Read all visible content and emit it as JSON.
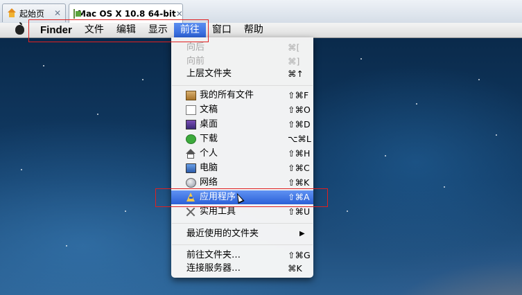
{
  "vm_tabs": [
    {
      "label": "起始页",
      "icon": "home-icon"
    },
    {
      "label": "Mac OS X 10.8 64-bit",
      "icon": "vm-icon"
    }
  ],
  "tab_close": "✕",
  "menubar": {
    "app_name": "Finder",
    "menus": [
      "文件",
      "编辑",
      "显示",
      "前往",
      "窗口",
      "帮助"
    ],
    "active_menu": "前往"
  },
  "go_menu": {
    "items": [
      {
        "label": "向后",
        "shortcut": "⌘[",
        "disabled": true
      },
      {
        "label": "向前",
        "shortcut": "⌘]",
        "disabled": true
      },
      {
        "label": "上层文件夹",
        "shortcut": "⌘↑"
      },
      {
        "label": "我的所有文件",
        "shortcut": "⇧⌘F",
        "icon": "all-my-files-icon"
      },
      {
        "label": "文稿",
        "shortcut": "⇧⌘O",
        "icon": "documents-icon"
      },
      {
        "label": "桌面",
        "shortcut": "⇧⌘D",
        "icon": "desktop-icon"
      },
      {
        "label": "下载",
        "shortcut": "⌥⌘L",
        "icon": "downloads-icon"
      },
      {
        "label": "个人",
        "shortcut": "⇧⌘H",
        "icon": "home-icon"
      },
      {
        "label": "电脑",
        "shortcut": "⇧⌘C",
        "icon": "computer-icon"
      },
      {
        "label": "网络",
        "shortcut": "⇧⌘K",
        "icon": "network-icon"
      },
      {
        "label": "应用程序",
        "shortcut": "⇧⌘A",
        "icon": "applications-icon",
        "selected": true
      },
      {
        "label": "实用工具",
        "shortcut": "⇧⌘U",
        "icon": "utilities-icon"
      },
      {
        "label": "最近使用的文件夹",
        "submenu_arrow": "▶"
      },
      {
        "label": "前往文件夹…",
        "shortcut": "⇧⌘G"
      },
      {
        "label": "连接服务器…",
        "shortcut": "⌘K"
      }
    ]
  },
  "colors": {
    "highlight_box": "#e02020",
    "menu_selection": "#2b60d7"
  }
}
